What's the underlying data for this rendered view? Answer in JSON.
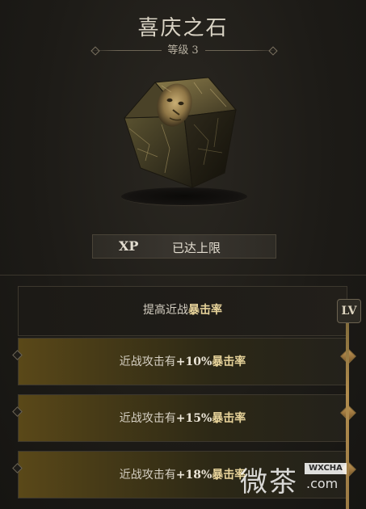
{
  "item": {
    "title": "喜庆之石",
    "level_label": "等级",
    "level_value": "3"
  },
  "xp": {
    "label": "XP",
    "value": "已达上限"
  },
  "perks": {
    "header": {
      "prefix": "提高近战",
      "highlight": "暴击率"
    },
    "rows": [
      {
        "prefix": "近战攻击有",
        "pct": "+10%",
        "highlight": "暴击率"
      },
      {
        "prefix": "近战攻击有",
        "pct": "+15%",
        "highlight": "暴击率"
      },
      {
        "prefix": "近战攻击有",
        "pct": "+18%",
        "highlight": "暴击率"
      }
    ]
  },
  "lv_badge": "LV",
  "watermark": {
    "big": "微茶",
    "badge": "WXCHA",
    "small": ".com"
  },
  "colors": {
    "background": "#1f1d19",
    "title_text": "#d9d3c4",
    "highlight": "#e7d39a",
    "gold_row": "#5a4818",
    "accent_diamond": "#c49a58"
  },
  "icons": [
    "cube-artifact-icon",
    "left-diamond-icon",
    "right-diamond-icon",
    "lv-badge-icon"
  ]
}
